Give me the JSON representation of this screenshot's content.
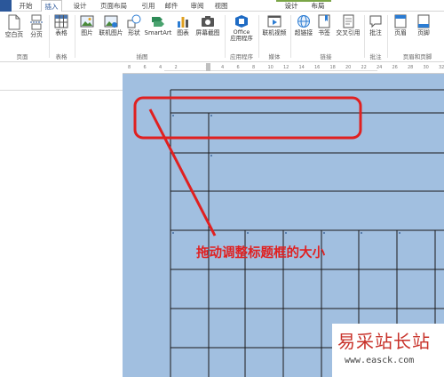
{
  "tabs": [
    {
      "label": "开始",
      "active": false
    },
    {
      "label": "插入",
      "active": true
    },
    {
      "label": "设计",
      "active": false
    },
    {
      "label": "页面布局",
      "active": false
    },
    {
      "label": "引用",
      "active": false
    },
    {
      "label": "邮件",
      "active": false
    },
    {
      "label": "审阅",
      "active": false
    },
    {
      "label": "视图",
      "active": false
    },
    {
      "label": "设计",
      "active": false,
      "context": true
    },
    {
      "label": "布局",
      "active": false,
      "context": true
    }
  ],
  "ribbon": {
    "buttons": {
      "cover_page": "空白页",
      "page_break": "分页",
      "table": "表格",
      "picture": "图片",
      "online_picture": "联机图片",
      "shapes": "形状",
      "smartart": "SmartArt",
      "chart": "图表",
      "screenshot": "屏幕截图",
      "office_apps": "Office\n应用程序",
      "online_video": "联机视频",
      "hyperlink": "超链接",
      "bookmark": "书签",
      "cross_ref": "交叉引用",
      "comment": "批注",
      "header": "页眉",
      "footer": "页脚"
    },
    "groups": {
      "pages": "页面",
      "tables": "表格",
      "illustrations": "插图",
      "apps": "应用程序",
      "media": "媒体",
      "links": "链接",
      "comments": "批注",
      "header_footer": "页眉和页脚"
    }
  },
  "ruler": {
    "ticks": [
      "8",
      "6",
      "4",
      "2",
      "",
      "2",
      "4",
      "6",
      "8",
      "10",
      "12",
      "14",
      "16",
      "18",
      "20",
      "22",
      "24",
      "26",
      "28",
      "30",
      "32"
    ]
  },
  "document": {
    "callout_text": "拖动调整标题框的大小"
  },
  "watermark": {
    "title": "易采站长站",
    "url": "www.easck.com"
  },
  "colors": {
    "page": "#a1bfe0",
    "accent": "#2b579a",
    "annotation": "#e02020"
  }
}
